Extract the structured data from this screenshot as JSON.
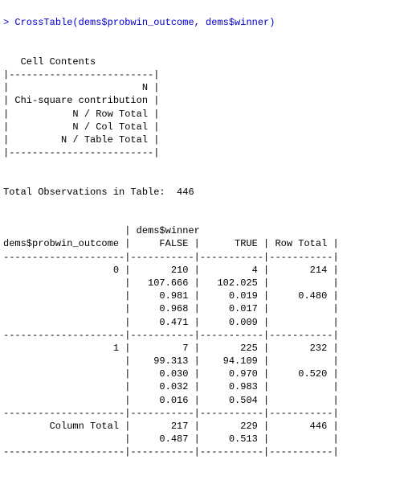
{
  "console": {
    "prompt": ">",
    "command": "CrossTable(dems$probwin_outcome, dems$winner)",
    "output": "\n \n   Cell Contents\n|-------------------------|\n|                       N |\n| Chi-square contribution |\n|           N / Row Total |\n|           N / Col Total |\n|         N / Table Total |\n|-------------------------|\n\n \nTotal Observations in Table:  446 \n\n \n                     | dems$winner \ndems$probwin_outcome |     FALSE |      TRUE | Row Total | \n---------------------|-----------|-----------|-----------|\n                   0 |       210 |         4 |       214 | \n                     |   107.666 |   102.025 |           | \n                     |     0.981 |     0.019 |     0.480 | \n                     |     0.968 |     0.017 |           | \n                     |     0.471 |     0.009 |           | \n---------------------|-----------|-----------|-----------|\n                   1 |         7 |       225 |       232 | \n                     |    99.313 |    94.109 |           | \n                     |     0.030 |     0.970 |     0.520 | \n                     |     0.032 |     0.983 |           | \n                     |     0.016 |     0.504 |           | \n---------------------|-----------|-----------|-----------|\n        Column Total |       217 |       229 |       446 | \n                     |     0.487 |     0.513 |           | \n---------------------|-----------|-----------|-----------|"
  },
  "chart_data": {
    "type": "table",
    "title": "CrossTable: dems$probwin_outcome × dems$winner",
    "total_observations": 446,
    "cell_contents_legend": [
      "N",
      "Chi-square contribution",
      "N / Row Total",
      "N / Col Total",
      "N / Table Total"
    ],
    "row_variable": "dems$probwin_outcome",
    "col_variable": "dems$winner",
    "row_levels": [
      "0",
      "1"
    ],
    "col_levels": [
      "FALSE",
      "TRUE"
    ],
    "cells": {
      "0": {
        "FALSE": {
          "N": 210,
          "chi_sq": 107.666,
          "row_prop": 0.981,
          "col_prop": 0.968,
          "table_prop": 0.471
        },
        "TRUE": {
          "N": 4,
          "chi_sq": 102.025,
          "row_prop": 0.019,
          "col_prop": 0.017,
          "table_prop": 0.009
        },
        "RowTotal": {
          "N": 214,
          "row_prop": 0.48
        }
      },
      "1": {
        "FALSE": {
          "N": 7,
          "chi_sq": 99.313,
          "row_prop": 0.03,
          "col_prop": 0.032,
          "table_prop": 0.016
        },
        "TRUE": {
          "N": 225,
          "chi_sq": 94.109,
          "row_prop": 0.97,
          "col_prop": 0.983,
          "table_prop": 0.504
        },
        "RowTotal": {
          "N": 232,
          "row_prop": 0.52
        }
      }
    },
    "column_totals": {
      "FALSE": {
        "N": 217,
        "col_prop": 0.487
      },
      "TRUE": {
        "N": 229,
        "col_prop": 0.513
      },
      "GrandTotal": 446
    }
  }
}
